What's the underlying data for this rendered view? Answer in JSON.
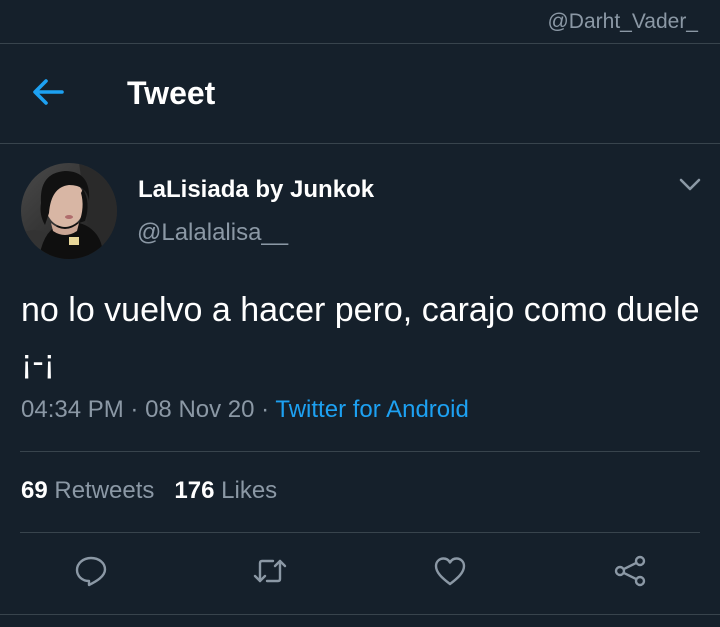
{
  "watermark": "@Darht_Vader_",
  "header": {
    "title": "Tweet",
    "back_icon": "arrow-left-icon"
  },
  "tweet": {
    "author": {
      "display_name": "LaLisiada by Junkok",
      "handle": "@Lalalalisa__",
      "avatar": "avatar-photo"
    },
    "more_icon": "chevron-down-icon",
    "text": "no lo vuelvo a hacer pero, carajo como duele ¡-¡",
    "time": "04:34 PM",
    "date": "08 Nov 20",
    "separator": "·",
    "source": "Twitter for Android",
    "stats": {
      "retweets_count": "69",
      "retweets_label": "Retweets",
      "likes_count": "176",
      "likes_label": "Likes"
    },
    "actions": [
      "reply-icon",
      "retweet-icon",
      "like-icon",
      "share-icon"
    ]
  },
  "colors": {
    "background": "#15202b",
    "divider": "#38444d",
    "text_primary": "#ffffff",
    "text_secondary": "#8b98a5",
    "accent": "#1da1f2"
  }
}
